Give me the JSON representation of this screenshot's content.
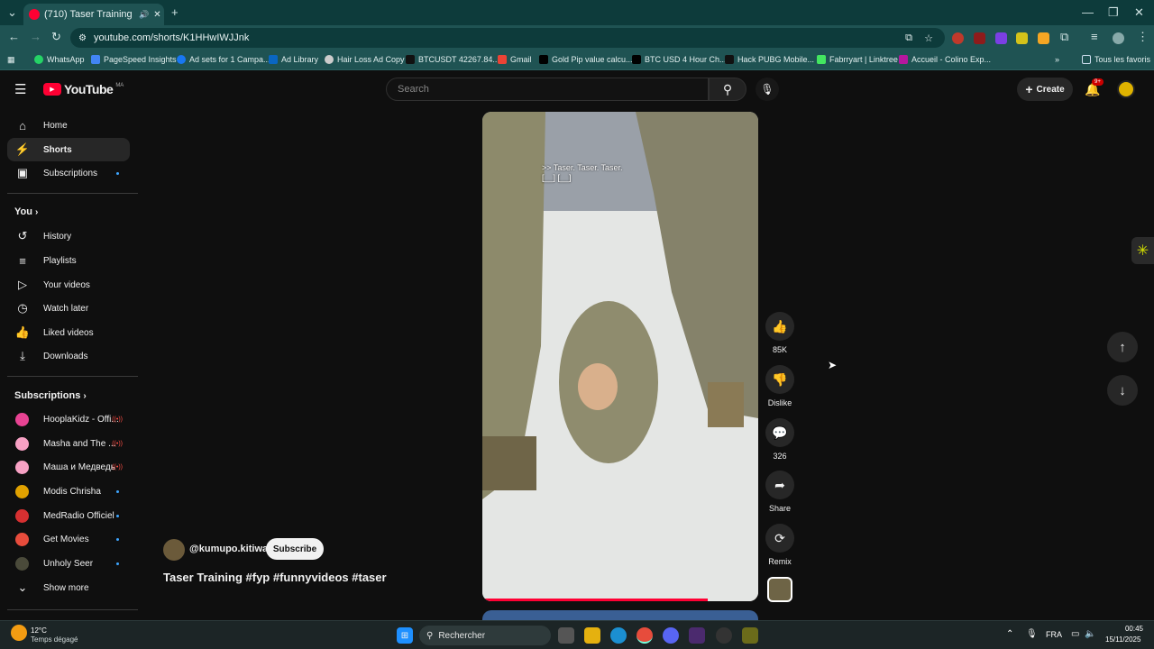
{
  "browser": {
    "tab_title": "(710) Taser Training #fyp #f",
    "url": "youtube.com/shorts/K1HHwIWJJnk",
    "bookmarks": [
      "WhatsApp",
      "PageSpeed Insights",
      "Ad sets for 1 Campa...",
      "Ad Library",
      "Hair Loss Ad Copy",
      "BTCUSDT 42267.84...",
      "Gmail",
      "Gold Pip value calcu...",
      "BTC USD 4 Hour Ch...",
      "Hack PUBG Mobile...",
      "Fabrryart | Linktree",
      "Accueil - Colino Exp..."
    ],
    "all_bookmarks": "Tous les favoris"
  },
  "youtube": {
    "logo": "YouTube",
    "logo_region": "MA",
    "search_placeholder": "Search",
    "create_label": "Create",
    "notif_badge": "9+",
    "nav": [
      "Home",
      "Shorts",
      "Subscriptions"
    ],
    "you_header": "You",
    "you_items": [
      "History",
      "Playlists",
      "Your videos",
      "Watch later",
      "Liked videos",
      "Downloads"
    ],
    "subs_header": "Subscriptions",
    "subscriptions": [
      "HooplaKidz - Offi...",
      "Masha and The ...",
      "Маша и Медведь",
      "Modis Chrisha",
      "MedRadio Officiel",
      "Get Movies",
      "Unholy Seer"
    ],
    "show_more": "Show more",
    "channel": "@kumupo.kitiwa",
    "subscribe": "Subscribe",
    "short_title": "Taser Training #fyp #funnyvideos #taser",
    "caption": ">> Taser. Taser. Taser.",
    "caption2": "[__] [__]",
    "likes": "85K",
    "dislike": "Dislike",
    "comments": "326",
    "share": "Share",
    "remix": "Remix"
  },
  "taskbar": {
    "weather_temp": "12°C",
    "weather_desc": "Temps dégagé",
    "search": "Rechercher",
    "lang": "FRA",
    "time": "00:45",
    "date": "15/11/2025"
  },
  "colors": {
    "accent": "#ff0033",
    "teal": "#1f5353"
  }
}
